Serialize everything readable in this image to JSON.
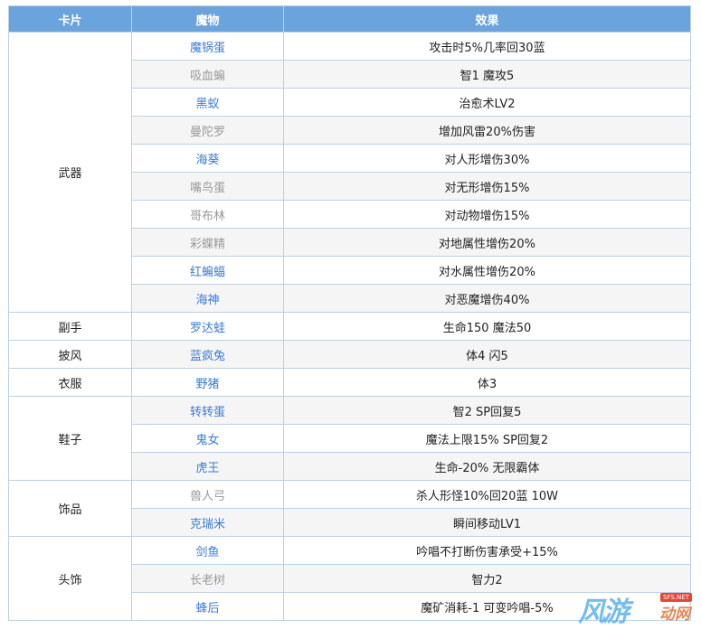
{
  "headers": {
    "card": "卡片",
    "monster": "魔物",
    "effect": "效果"
  },
  "groups": [
    {
      "category": "武器",
      "items": [
        {
          "monster": "魔锅蛋",
          "effect": "攻击时5%几率回30蓝",
          "style": "link"
        },
        {
          "monster": "吸血蝙",
          "effect": "智1 魔攻5",
          "style": "gray"
        },
        {
          "monster": "黑蚁",
          "effect": "治愈术LV2",
          "style": "link"
        },
        {
          "monster": "曼陀罗",
          "effect": "增加风雷20%伤害",
          "style": "gray"
        },
        {
          "monster": "海葵",
          "effect": "对人形增伤30%",
          "style": "link"
        },
        {
          "monster": "嘴鸟蛋",
          "effect": "对无形增伤15%",
          "style": "gray"
        },
        {
          "monster": "哥布林",
          "effect": "对动物增伤15%",
          "style": "gray"
        },
        {
          "monster": "彩蝶精",
          "effect": "对地属性增伤20%",
          "style": "gray"
        },
        {
          "monster": "红蝙蝠",
          "effect": "对水属性增伤20%",
          "style": "link"
        },
        {
          "monster": "海神",
          "effect": "对恶魔增伤40%",
          "style": "link"
        }
      ]
    },
    {
      "category": "副手",
      "items": [
        {
          "monster": "罗达蛙",
          "effect": "生命150 魔法50",
          "style": "link"
        }
      ]
    },
    {
      "category": "披风",
      "items": [
        {
          "monster": "蓝疯兔",
          "effect": "体4 闪5",
          "style": "link"
        }
      ]
    },
    {
      "category": "衣服",
      "items": [
        {
          "monster": "野猪",
          "effect": "体3",
          "style": "link"
        }
      ]
    },
    {
      "category": "鞋子",
      "items": [
        {
          "monster": "转转蛋",
          "effect": "智2 SP回复5",
          "style": "link"
        },
        {
          "monster": "鬼女",
          "effect": "魔法上限15% SP回复2",
          "style": "link"
        },
        {
          "monster": "虎王",
          "effect": "生命-20% 无限霸体",
          "style": "link"
        }
      ]
    },
    {
      "category": "饰品",
      "items": [
        {
          "monster": "兽人弓",
          "effect": "杀人形怪10%回20蓝 10W",
          "style": "gray"
        },
        {
          "monster": "克瑞米",
          "effect": "瞬间移动LV1",
          "style": "link"
        }
      ]
    },
    {
      "category": "头饰",
      "items": [
        {
          "monster": "剑鱼",
          "effect": "吟唱不打断伤害承受+15%",
          "style": "link"
        },
        {
          "monster": "长老树",
          "effect": "智力2",
          "style": "gray"
        },
        {
          "monster": "蜂后",
          "effect": "魔矿消耗-1 可变吟唱-5%",
          "style": "link"
        }
      ]
    }
  ],
  "watermark": {
    "main": "风游",
    "sub": "动网",
    "tag": "SFS.NET"
  }
}
